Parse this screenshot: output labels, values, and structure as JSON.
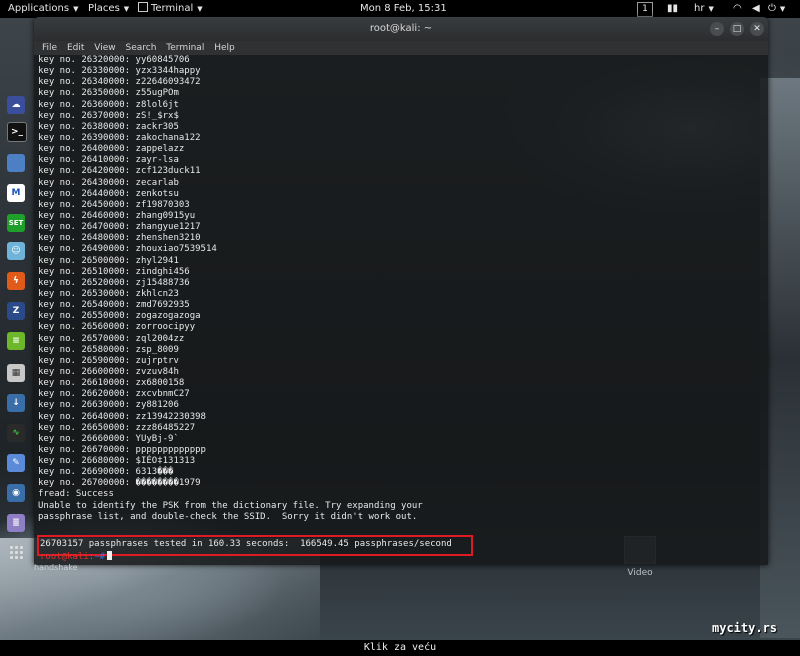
{
  "topbar": {
    "applications": "Applications",
    "places": "Places",
    "terminal": "Terminal",
    "clock": "Mon  8 Feb, 15:31",
    "workspace": "1",
    "keyboard": "hr"
  },
  "window": {
    "title": "root@kali: ~",
    "minimize": "–",
    "maximize": "□",
    "close": "✕"
  },
  "menu": [
    "File",
    "Edit",
    "View",
    "Search",
    "Terminal",
    "Help"
  ],
  "terminal": {
    "lines": [
      "key no. 26320000: yy60845706",
      "key no. 26330000: yzx3344happy",
      "key no. 26340000: z22646093472",
      "key no. 26350000: z55ugPOm",
      "key no. 26360000: z8lol6jt",
      "key no. 26370000: zS!_$rx$",
      "key no. 26380000: zackr305",
      "key no. 26390000: zakochana122",
      "key no. 26400000: zappelazz",
      "key no. 26410000: zayr-lsa",
      "key no. 26420000: zcf123duck11",
      "key no. 26430000: zecarlab",
      "key no. 26440000: zenkotsu",
      "key no. 26450000: zf19870303",
      "key no. 26460000: zhang0915yu",
      "key no. 26470000: zhangyue1217",
      "key no. 26480000: zhenshen3210",
      "key no. 26490000: zhouxiao7539514",
      "key no. 26500000: zhyl2941",
      "key no. 26510000: zindghi456",
      "key no. 26520000: zj15488736",
      "key no. 26530000: zkhlcn23",
      "key no. 26540000: zmd7692935",
      "key no. 26550000: zogazogazoga",
      "key no. 26560000: zorroocipyy",
      "key no. 26570000: zql2004zz",
      "key no. 26580000: zsp_8009",
      "key no. 26590000: zujrptrv",
      "key no. 26600000: zvzuv84h",
      "key no. 26610000: zx6800158",
      "key no. 26620000: zxcvbnmC27",
      "key no. 26630000: zy881206",
      "key no. 26640000: zz13942230398",
      "key no. 26650000: zzz86485227",
      "key no. 26660000: YUyBj-9`",
      "key no. 26670000: ppppppppppppp",
      "key no. 26680000: $IÉO‡131313",
      "key no. 26690000: 6313���",
      "key no. 26700000: ��������1979",
      "fread: Success",
      "Unable to identify the PSK from the dictionary file. Try expanding your",
      "passphrase list, and double-check the SSID.  Sorry it didn't work out."
    ],
    "summary": "26703157 passphrases tested in 160.33 seconds:  166549.45 passphrases/second",
    "prompt_user": "root@kali",
    "prompt_arrow": ":~#"
  },
  "desktop": {
    "handshake_label": "handshake",
    "video_label": "Video"
  },
  "dock_icons": [
    "ghost-icon",
    "terminal-icon",
    "folder-icon",
    "metasploit-icon",
    "set-icon",
    "maltego-icon",
    "burp-icon",
    "zap-icon",
    "notes-icon",
    "keyboard-icon",
    "download-icon",
    "monitor-icon",
    "cleaner-icon",
    "camera-icon",
    "text-editor-icon"
  ],
  "footer": {
    "caption": "Klik za veću",
    "watermark": "mycity.rs"
  }
}
